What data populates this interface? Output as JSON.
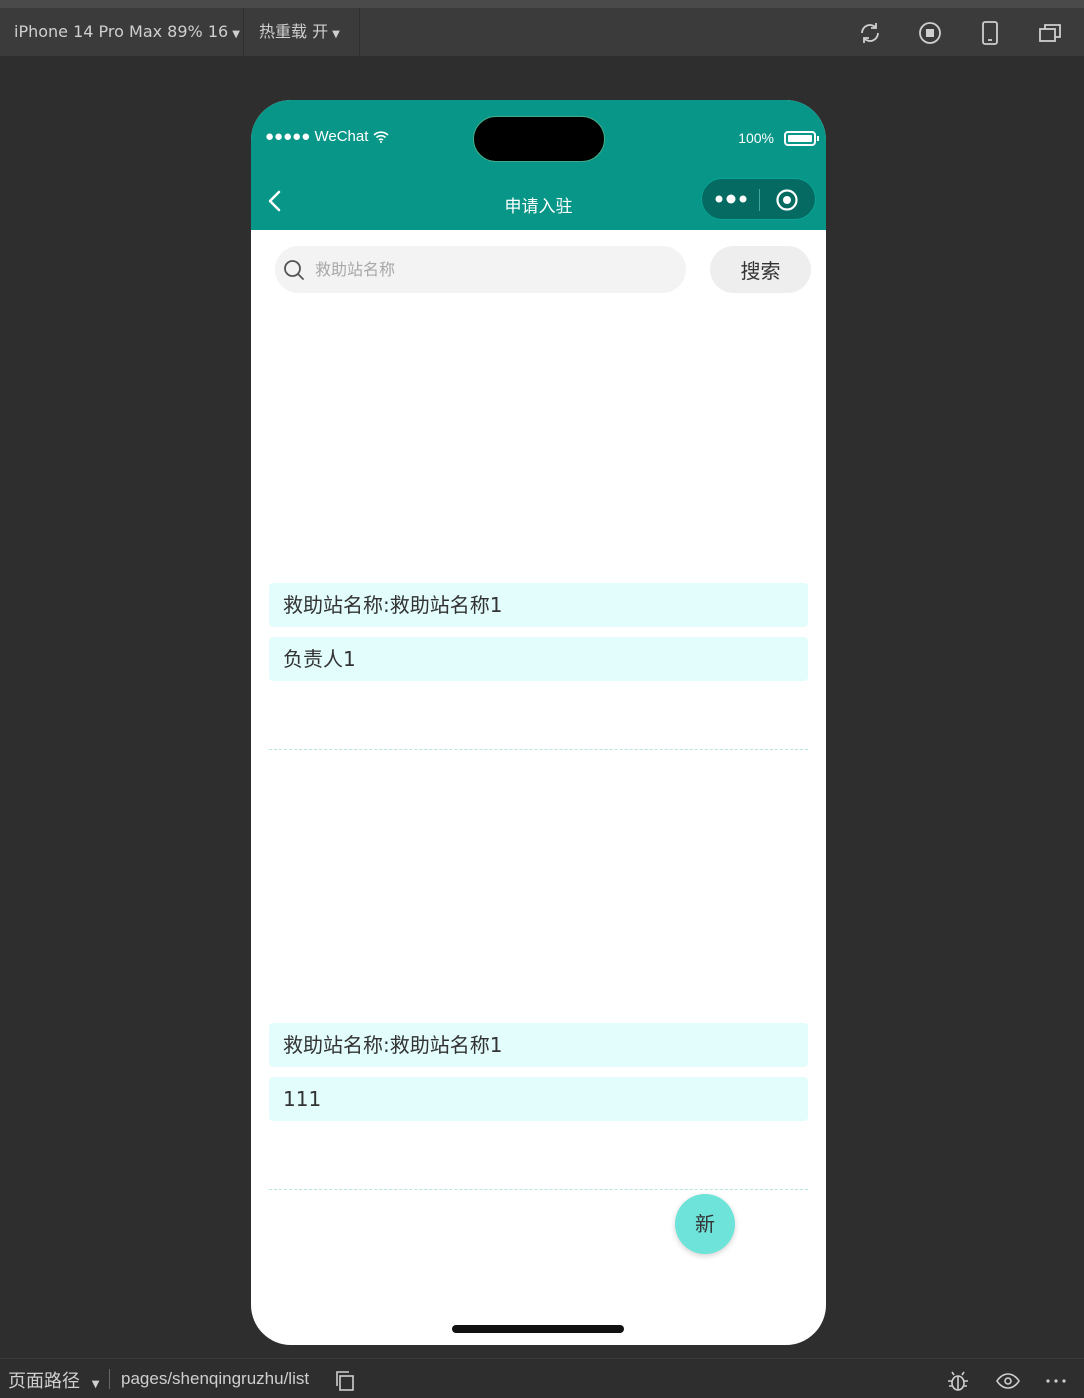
{
  "toolbar": {
    "device": "iPhone 14 Pro Max 89% 16",
    "hot_reload": "热重载 开",
    "icons": [
      "refresh-icon",
      "stop-icon",
      "phone-icon",
      "window-icon"
    ]
  },
  "status_bar": {
    "carrier": "●●●●● WeChat",
    "battery": "100%"
  },
  "navbar": {
    "title": "申请入驻"
  },
  "search": {
    "placeholder": "救助站名称",
    "button_label": "搜索"
  },
  "list": {
    "items": [
      {
        "name": "救助站名称:救助站名称1",
        "contact": "负责人1"
      },
      {
        "name": "救助站名称:救助站名称1",
        "contact": "111"
      }
    ]
  },
  "fab": {
    "label": "新"
  },
  "bottom_bar": {
    "path_label": "页面路径",
    "path": "pages/shenqingruzhu/list"
  },
  "colors": {
    "accent": "#079688",
    "field_bg": "#e2fdfc",
    "fab": "#6de3d9"
  }
}
